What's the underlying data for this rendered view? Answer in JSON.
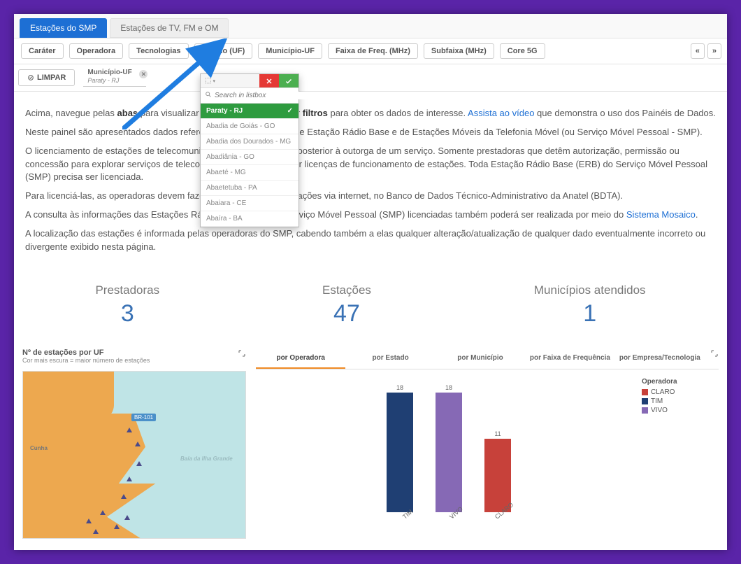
{
  "top_tabs": {
    "active": "Estações do SMP",
    "other": "Estações de TV, FM e OM"
  },
  "filter_tabs": [
    "Caráter",
    "Operadora",
    "Tecnologias",
    "Estado (UF)",
    "Município-UF",
    "Faixa de Freq. (MHz)",
    "Subfaixa (MHz)",
    "Core 5G"
  ],
  "pager": {
    "prev": "«",
    "next": "»"
  },
  "limpar": "LIMPAR",
  "chip": {
    "title": "Município-UF",
    "value": "Paraty - RJ"
  },
  "dropdown": {
    "sel_icon": "⁞",
    "search_placeholder": "Search in listbox",
    "items": [
      {
        "label": "Paraty - RJ",
        "selected": true
      },
      {
        "label": "Abadia de Goiás - GO",
        "selected": false
      },
      {
        "label": "Abadia dos Dourados - MG",
        "selected": false
      },
      {
        "label": "Abadiânia - GO",
        "selected": false
      },
      {
        "label": "Abaeté - MG",
        "selected": false
      },
      {
        "label": "Abaetetuba - PA",
        "selected": false
      },
      {
        "label": "Abaiara - CE",
        "selected": false
      },
      {
        "label": "Abaíra - BA",
        "selected": false
      }
    ]
  },
  "body": {
    "p1a": "Acima, navegue pelas ",
    "p1b": "abas",
    "p1c": " para visualizar as informações e aplicar ",
    "p1d": "filtros",
    "p1e": " para obter os dados de interesse. ",
    "link1": "Assista ao vídeo",
    "p1f": " que demonstra o uso dos Painéis de Dados.",
    "p2": "Neste painel são apresentados dados referentes ao licenciamento de Estação Rádio Base e de Estações Móveis da Telefonia Móvel (ou Serviço Móvel Pessoal - SMP).",
    "p3": "O licenciamento de estações de telecomunicações é procedimento posterior à outorga de um serviço. Somente prestadoras que detêm autorização, permissão ou concessão para explorar serviços de telecomunicações podem obter licenças de funcionamento de estações. Toda Estação Rádio Base (ERB) do Serviço Móvel Pessoal (SMP) precisa ser licenciada.",
    "p4": "Para licenciá-las, as operadoras devem fazer o cadastro das informações via internet, no Banco de Dados Técnico-Administrativo da Anatel (BDTA).",
    "p5a": "A consulta às informações das Estações Rádio Base (ERBs) do Serviço Móvel Pessoal (SMP) licenciadas também poderá ser realizada por meio do ",
    "link2": "Sistema Mosaico",
    "p5b": ".",
    "p6": "A localização das estações é informada pelas operadoras do SMP, cabendo também a elas qualquer alteração/atualização de qualquer dado eventualmente incorreto ou divergente exibido nesta página."
  },
  "kpis": [
    {
      "label": "Prestadoras",
      "value": "3"
    },
    {
      "label": "Estações",
      "value": "47"
    },
    {
      "label": "Municípios atendidos",
      "value": "1"
    }
  ],
  "map": {
    "title": "Nº de estações por UF",
    "sub": "Cor mais escura = maior número de estações",
    "road": "BR-101",
    "town1": "Cunha",
    "bay": "Baía da Ilha Grande"
  },
  "chart_tabs": [
    "por Operadora",
    "por Estado",
    "por Município",
    "por Faixa de Frequência",
    "por Empresa/Tecnologia"
  ],
  "legend": {
    "title": "Operadora",
    "items": [
      {
        "name": "CLARO",
        "color": "#c7413a"
      },
      {
        "name": "TIM",
        "color": "#1f3f73"
      },
      {
        "name": "VIVO",
        "color": "#8669b5"
      }
    ]
  },
  "chart_data": {
    "type": "bar",
    "categories": [
      "TIM",
      "VIVO",
      "CLARO"
    ],
    "values": [
      18,
      18,
      11
    ],
    "colors": [
      "#1f3f73",
      "#8669b5",
      "#c7413a"
    ],
    "title": "por Operadora",
    "xlabel": "",
    "ylabel": "",
    "ylim": [
      0,
      20
    ]
  }
}
